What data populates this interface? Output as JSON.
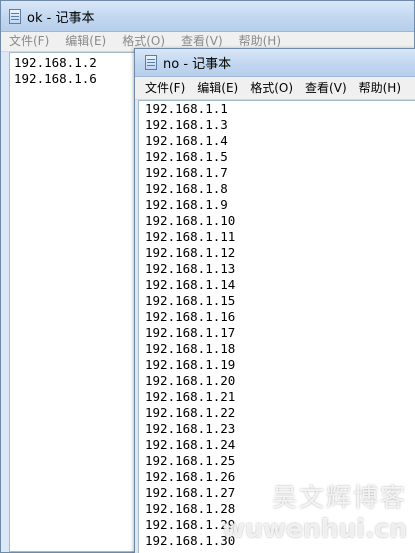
{
  "back_window": {
    "title": "ok - 记事本",
    "menu": [
      "文件(F)",
      "编辑(E)",
      "格式(O)",
      "查看(V)",
      "帮助(H)"
    ],
    "lines": [
      "192.168.1.2",
      "192.168.1.6"
    ]
  },
  "front_window": {
    "title": "no - 记事本",
    "menu": [
      "文件(F)",
      "编辑(E)",
      "格式(O)",
      "查看(V)",
      "帮助(H)"
    ],
    "lines": [
      "192.168.1.1",
      "192.168.1.3",
      "192.168.1.4",
      "192.168.1.5",
      "192.168.1.7",
      "192.168.1.8",
      "192.168.1.9",
      "192.168.1.10",
      "192.168.1.11",
      "192.168.1.12",
      "192.168.1.13",
      "192.168.1.14",
      "192.168.1.15",
      "192.168.1.16",
      "192.168.1.17",
      "192.168.1.18",
      "192.168.1.19",
      "192.168.1.20",
      "192.168.1.21",
      "192.168.1.22",
      "192.168.1.23",
      "192.168.1.24",
      "192.168.1.25",
      "192.168.1.26",
      "192.168.1.27",
      "192.168.1.28",
      "192.168.1.29",
      "192.168.1.30"
    ]
  },
  "watermark": {
    "line1": "吴文辉博客",
    "line2": "wuwenhui.cn"
  }
}
